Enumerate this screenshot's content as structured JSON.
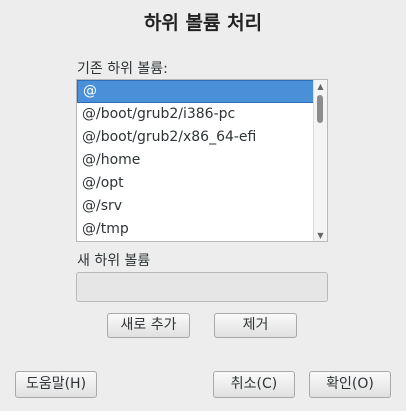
{
  "dialog": {
    "title": "하위 볼륨 처리"
  },
  "existing": {
    "label": "기존 하위 볼륨:",
    "items": [
      "@",
      "@/boot/grub2/i386-pc",
      "@/boot/grub2/x86_64-efi",
      "@/home",
      "@/opt",
      "@/srv",
      "@/tmp"
    ],
    "selected_index": 0
  },
  "new_subvolume": {
    "label": "새 하위 볼륨",
    "value": ""
  },
  "buttons": {
    "add": "새로 추가",
    "remove": "제거",
    "help": "도움말(H)",
    "cancel": "취소(C)",
    "ok": "확인(O)"
  }
}
